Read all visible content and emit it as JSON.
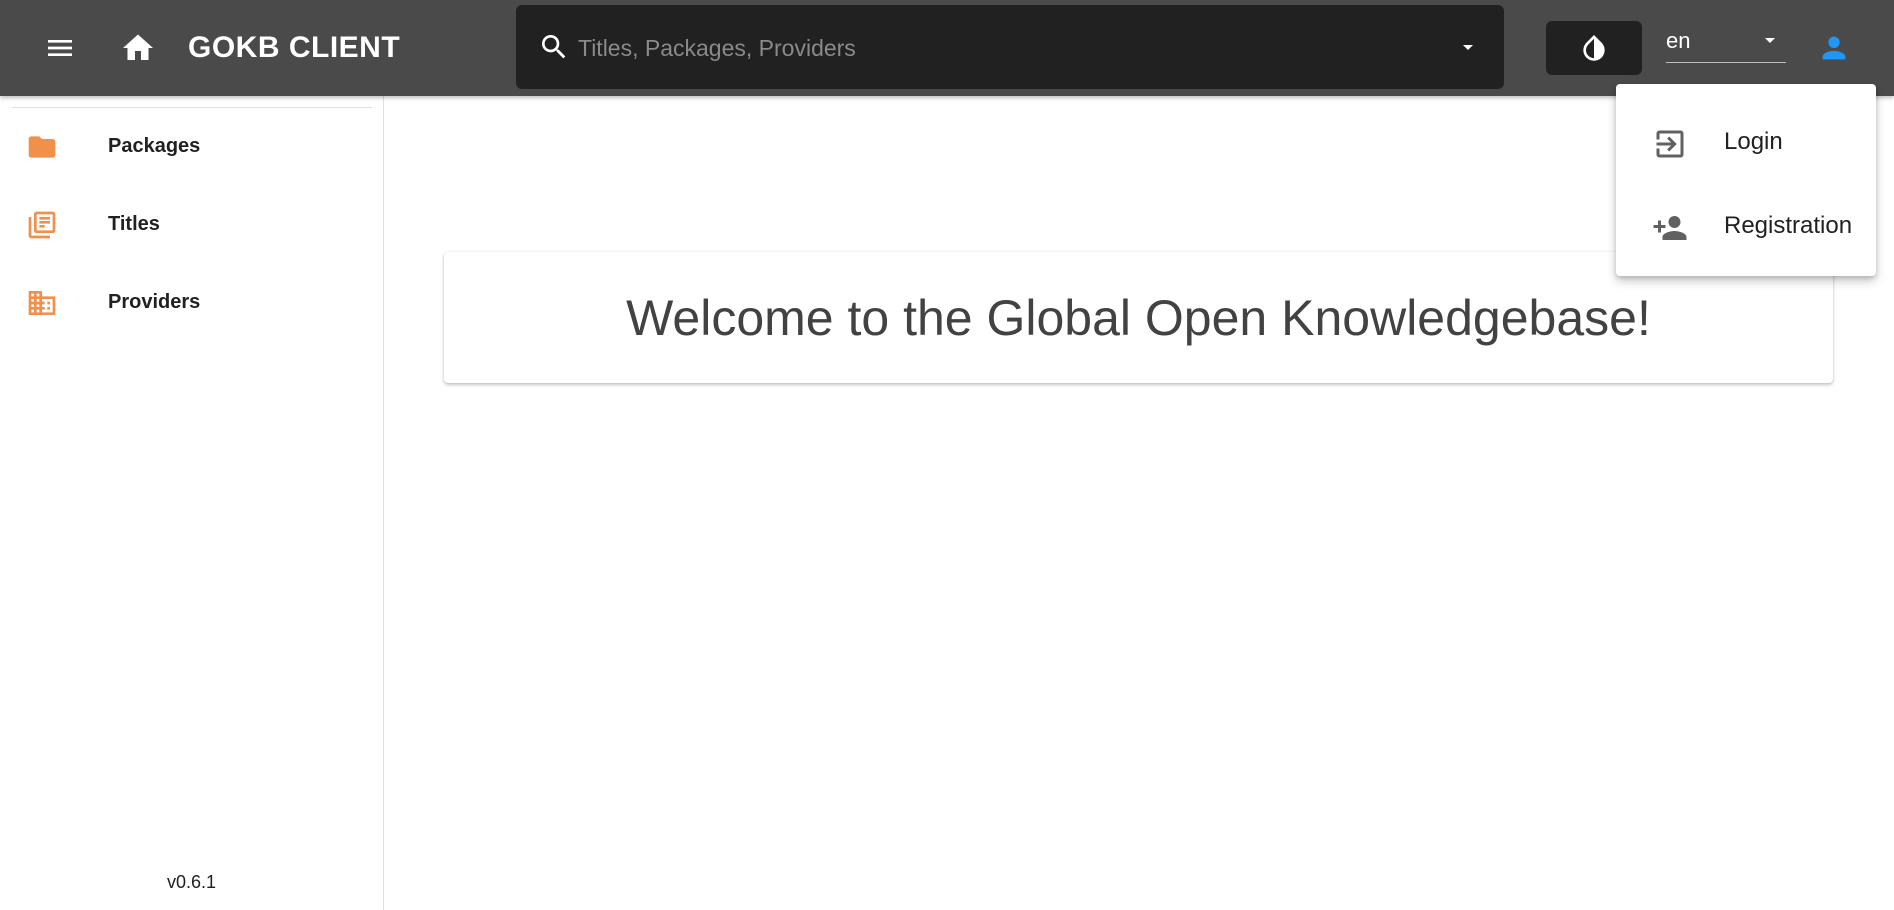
{
  "appbar": {
    "title": "GOKB CLIENT",
    "search": {
      "placeholder": "Titles, Packages, Providers",
      "value": ""
    },
    "language": {
      "selected": "en"
    },
    "colors": {
      "background": "#4a4a4a",
      "search_bg": "#212121",
      "user_icon": "#2196f3"
    },
    "icons": {
      "menu": "hamburger-menu-icon",
      "home": "home-icon",
      "search": "search-icon",
      "search_dropdown": "caret-down-icon",
      "theme": "invert-colors-icon",
      "language_dropdown": "caret-down-icon",
      "user": "account-icon"
    }
  },
  "sidebar": {
    "accent_color": "#f0904a",
    "items": [
      {
        "label": "Packages",
        "icon": "folder-icon"
      },
      {
        "label": "Titles",
        "icon": "library-books-icon"
      },
      {
        "label": "Providers",
        "icon": "domain-icon"
      }
    ],
    "version": "v0.6.1"
  },
  "main": {
    "welcome": "Welcome to the Global Open Knowledgebase!"
  },
  "user_menu": {
    "items": [
      {
        "label": "Login",
        "icon": "login-icon"
      },
      {
        "label": "Registration",
        "icon": "account-plus-icon"
      }
    ]
  }
}
